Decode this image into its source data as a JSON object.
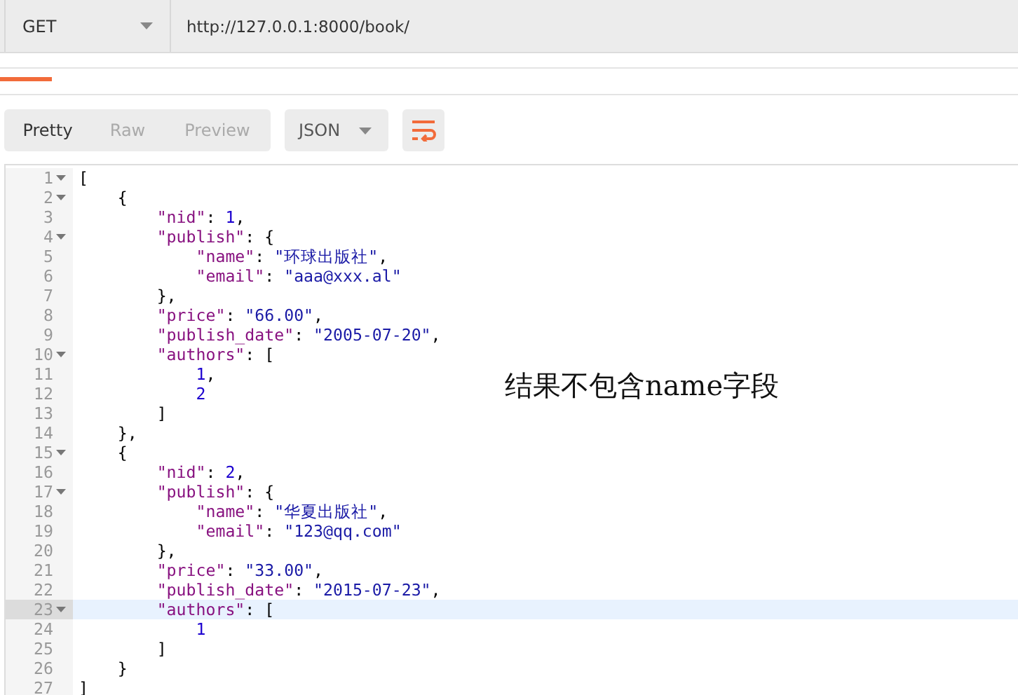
{
  "request": {
    "method": "GET",
    "url": "http://127.0.0.1:8000/book/"
  },
  "response_toolbar": {
    "views": [
      {
        "label": "Pretty",
        "selected": true
      },
      {
        "label": "Raw",
        "selected": false
      },
      {
        "label": "Preview",
        "selected": false
      }
    ],
    "format": "JSON"
  },
  "editor": {
    "lines": [
      {
        "number": "1",
        "foldable": true,
        "active": false,
        "tokens": [
          {
            "kind": "punct",
            "text": "["
          }
        ]
      },
      {
        "number": "2",
        "foldable": true,
        "active": false,
        "tokens": [
          {
            "kind": "punct",
            "text": "{"
          }
        ]
      },
      {
        "number": "3",
        "foldable": false,
        "active": false,
        "tokens": [
          {
            "kind": "key",
            "text": "\"nid\""
          },
          {
            "kind": "punct",
            "text": ": "
          },
          {
            "kind": "number",
            "text": "1"
          },
          {
            "kind": "punct",
            "text": ","
          }
        ]
      },
      {
        "number": "4",
        "foldable": true,
        "active": false,
        "tokens": [
          {
            "kind": "key",
            "text": "\"publish\""
          },
          {
            "kind": "punct",
            "text": ": {"
          }
        ]
      },
      {
        "number": "5",
        "foldable": false,
        "active": false,
        "tokens": [
          {
            "kind": "key",
            "text": "\"name\""
          },
          {
            "kind": "punct",
            "text": ": "
          },
          {
            "kind": "string",
            "text": "\"环球出版社\""
          },
          {
            "kind": "punct",
            "text": ","
          }
        ]
      },
      {
        "number": "6",
        "foldable": false,
        "active": false,
        "tokens": [
          {
            "kind": "key",
            "text": "\"email\""
          },
          {
            "kind": "punct",
            "text": ": "
          },
          {
            "kind": "string",
            "text": "\"aaa@xxx.al\""
          }
        ]
      },
      {
        "number": "7",
        "foldable": false,
        "active": false,
        "tokens": [
          {
            "kind": "punct",
            "text": "},"
          }
        ]
      },
      {
        "number": "8",
        "foldable": false,
        "active": false,
        "tokens": [
          {
            "kind": "key",
            "text": "\"price\""
          },
          {
            "kind": "punct",
            "text": ": "
          },
          {
            "kind": "string",
            "text": "\"66.00\""
          },
          {
            "kind": "punct",
            "text": ","
          }
        ]
      },
      {
        "number": "9",
        "foldable": false,
        "active": false,
        "tokens": [
          {
            "kind": "key",
            "text": "\"publish_date\""
          },
          {
            "kind": "punct",
            "text": ": "
          },
          {
            "kind": "string",
            "text": "\"2005-07-20\""
          },
          {
            "kind": "punct",
            "text": ","
          }
        ]
      },
      {
        "number": "10",
        "foldable": true,
        "active": false,
        "tokens": [
          {
            "kind": "key",
            "text": "\"authors\""
          },
          {
            "kind": "punct",
            "text": ": ["
          }
        ]
      },
      {
        "number": "11",
        "foldable": false,
        "active": false,
        "tokens": [
          {
            "kind": "number",
            "text": "1"
          },
          {
            "kind": "punct",
            "text": ","
          }
        ]
      },
      {
        "number": "12",
        "foldable": false,
        "active": false,
        "tokens": [
          {
            "kind": "number",
            "text": "2"
          }
        ]
      },
      {
        "number": "13",
        "foldable": false,
        "active": false,
        "tokens": [
          {
            "kind": "punct",
            "text": "]"
          }
        ]
      },
      {
        "number": "14",
        "foldable": false,
        "active": false,
        "tokens": [
          {
            "kind": "punct",
            "text": "},"
          }
        ]
      },
      {
        "number": "15",
        "foldable": true,
        "active": false,
        "tokens": [
          {
            "kind": "punct",
            "text": "{"
          }
        ]
      },
      {
        "number": "16",
        "foldable": false,
        "active": false,
        "tokens": [
          {
            "kind": "key",
            "text": "\"nid\""
          },
          {
            "kind": "punct",
            "text": ": "
          },
          {
            "kind": "number",
            "text": "2"
          },
          {
            "kind": "punct",
            "text": ","
          }
        ]
      },
      {
        "number": "17",
        "foldable": true,
        "active": false,
        "tokens": [
          {
            "kind": "key",
            "text": "\"publish\""
          },
          {
            "kind": "punct",
            "text": ": {"
          }
        ]
      },
      {
        "number": "18",
        "foldable": false,
        "active": false,
        "tokens": [
          {
            "kind": "key",
            "text": "\"name\""
          },
          {
            "kind": "punct",
            "text": ": "
          },
          {
            "kind": "string",
            "text": "\"华夏出版社\""
          },
          {
            "kind": "punct",
            "text": ","
          }
        ]
      },
      {
        "number": "19",
        "foldable": false,
        "active": false,
        "tokens": [
          {
            "kind": "key",
            "text": "\"email\""
          },
          {
            "kind": "punct",
            "text": ": "
          },
          {
            "kind": "string",
            "text": "\"123@qq.com\""
          }
        ]
      },
      {
        "number": "20",
        "foldable": false,
        "active": false,
        "tokens": [
          {
            "kind": "punct",
            "text": "},"
          }
        ]
      },
      {
        "number": "21",
        "foldable": false,
        "active": false,
        "tokens": [
          {
            "kind": "key",
            "text": "\"price\""
          },
          {
            "kind": "punct",
            "text": ": "
          },
          {
            "kind": "string",
            "text": "\"33.00\""
          },
          {
            "kind": "punct",
            "text": ","
          }
        ]
      },
      {
        "number": "22",
        "foldable": false,
        "active": false,
        "tokens": [
          {
            "kind": "key",
            "text": "\"publish_date\""
          },
          {
            "kind": "punct",
            "text": ": "
          },
          {
            "kind": "string",
            "text": "\"2015-07-23\""
          },
          {
            "kind": "punct",
            "text": ","
          }
        ]
      },
      {
        "number": "23",
        "foldable": true,
        "active": true,
        "tokens": [
          {
            "kind": "key",
            "text": "\"authors\""
          },
          {
            "kind": "punct",
            "text": ": ["
          }
        ]
      },
      {
        "number": "24",
        "foldable": false,
        "active": false,
        "tokens": [
          {
            "kind": "number",
            "text": "1"
          }
        ]
      },
      {
        "number": "25",
        "foldable": false,
        "active": false,
        "tokens": [
          {
            "kind": "punct",
            "text": "]"
          }
        ]
      },
      {
        "number": "26",
        "foldable": false,
        "active": false,
        "tokens": [
          {
            "kind": "punct",
            "text": "}"
          }
        ]
      },
      {
        "number": "27",
        "foldable": false,
        "active": false,
        "tokens": [
          {
            "kind": "punct",
            "text": "]"
          }
        ]
      }
    ]
  },
  "annotation": "结果不包含name字段"
}
